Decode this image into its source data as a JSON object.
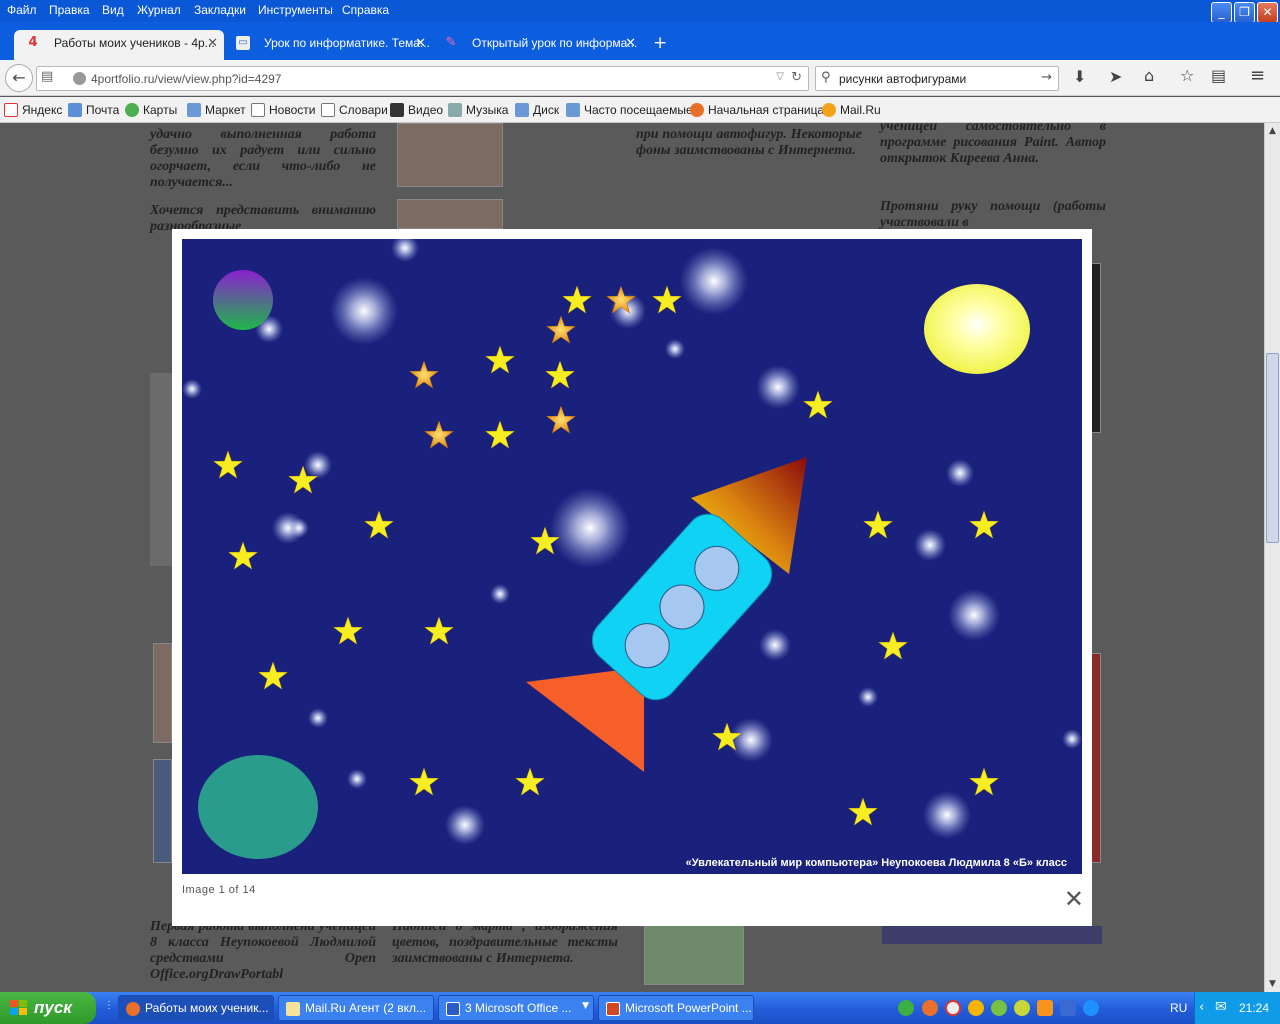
{
  "menu": [
    "Файл",
    "Правка",
    "Вид",
    "Журнал",
    "Закладки",
    "Инструменты",
    "Справка"
  ],
  "tabs": [
    {
      "label": "Работы моих учеников - 4р...",
      "active": true
    },
    {
      "label": "Урок по информатике. Тема...",
      "active": false
    },
    {
      "label": "Открытый урок по информа...",
      "active": false
    }
  ],
  "url": "4portfolio.ru/view/view.php?id=4297",
  "search": {
    "value": "рисунки автофигурами"
  },
  "bookmarks": [
    "Яндекс",
    "Почта",
    "Карты",
    "Маркет",
    "Новости",
    "Словари",
    "Видео",
    "Музыка",
    "Диск",
    "Часто посещаемые",
    "Начальная страница",
    "Mail.Ru"
  ],
  "page_text": {
    "col1a": "удачно выполненная работа безумно их радует или сильно огорчает, если что-либо не получается...",
    "col1b": "Хочется представить вниманию разнообразные",
    "col2": "при помощи автофигур. Некоторые фоны заимствованы с Интернета.",
    "col3a": "ученицей самостоятельно в программе рисования Paint. Автор открыток Киреева Анна.",
    "col3b": "Протяни руку помощи (работы участвовали в",
    "bottom1": "Первая работа выполнена ученицей 8 класса Неупокоевой Людмилой средствами Open Office.orgDrawPortabl",
    "bottom2": "Надписи 8 марта , изображения цветов, поздравительные тексты заимствованы с Интернета."
  },
  "lightbox": {
    "caption": "Image 1 of 14",
    "close": "✕",
    "picture_text": "«Увлекательный мир компьютера»  Неупокоева Людмила 8 «Б» класс"
  },
  "taskbar": {
    "start": "пуск",
    "tasks": [
      "Работы моих ученик...",
      "Mail.Ru Агент (2 вкл...",
      "3 Microsoft Office ...",
      "Microsoft PowerPoint ..."
    ],
    "lang": "RU",
    "time": "21:24"
  }
}
